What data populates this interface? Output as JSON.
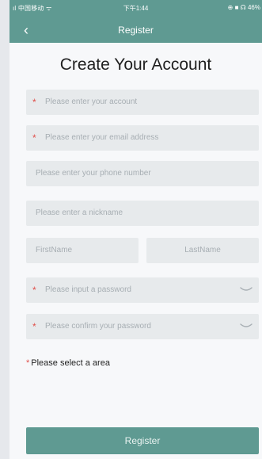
{
  "status_bar": {
    "carrier": "ıl 中国移动 ᯤ",
    "time": "下午1:44",
    "indicators": "⊕ ■ ☊ 46%"
  },
  "nav": {
    "back_icon": "‹",
    "title": "Register"
  },
  "heading": "Create Your Account",
  "fields": {
    "account": {
      "placeholder": "Please enter your account",
      "required": true
    },
    "email": {
      "placeholder": "Please enter your email address",
      "required": true
    },
    "phone": {
      "placeholder": "Please enter your phone number",
      "required": false
    },
    "nickname": {
      "placeholder": "Please enter a nickname",
      "required": false
    },
    "first_name": {
      "placeholder": "FirstName",
      "required": false
    },
    "last_name": {
      "placeholder": "LastName",
      "required": false
    },
    "password": {
      "placeholder": "Please input a password",
      "required": true,
      "icon": "eye-closed-icon"
    },
    "confirm_password": {
      "placeholder": "Please confirm your password",
      "required": true,
      "icon": "eye-closed-icon"
    }
  },
  "required_mark": "*",
  "area_label": "Please select a area",
  "register_button": "Register",
  "colors": {
    "accent": "#5f9a92",
    "required": "#e0504b",
    "field_bg": "#e7eaec",
    "placeholder": "#a7aeb3"
  }
}
